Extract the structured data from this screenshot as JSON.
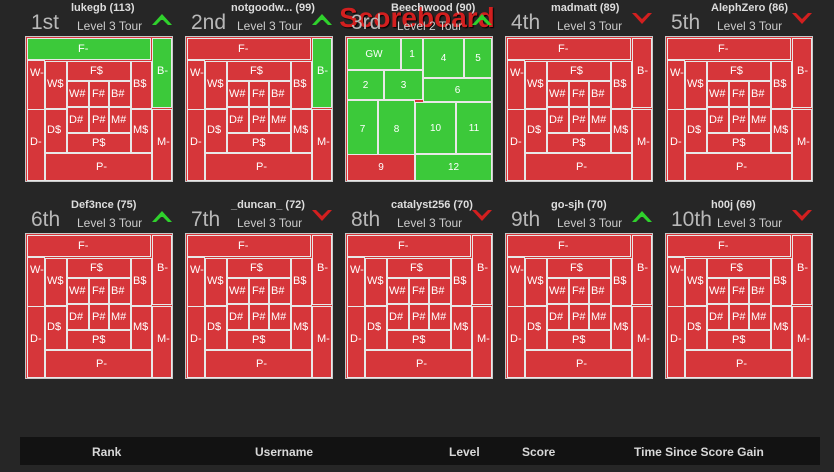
{
  "title": "Scoreboard",
  "entries": [
    {
      "rank": "1st",
      "user": "lukegb (113)",
      "level": "Level 3 Tour",
      "trend": "up",
      "owned": [
        "F-",
        "B-"
      ]
    },
    {
      "rank": "2nd",
      "user": "notgoodw... (99)",
      "level": "Level 3 Tour",
      "trend": "up",
      "owned": [
        "B-"
      ]
    },
    {
      "rank": "3rd",
      "user": "Beechwood (90)",
      "level": "Level 2 Tour",
      "trend": "up",
      "owned": []
    },
    {
      "rank": "4th",
      "user": "madmatt (89)",
      "level": "Level 3 Tour",
      "trend": "down",
      "owned": []
    },
    {
      "rank": "5th",
      "user": "AlephZero (86)",
      "level": "Level 3 Tour",
      "trend": "down",
      "owned": []
    },
    {
      "rank": "6th",
      "user": "Def3nce (75)",
      "level": "Level 3 Tour",
      "trend": "up",
      "owned": []
    },
    {
      "rank": "7th",
      "user": "_duncan_ (72)",
      "level": "Level 3 Tour",
      "trend": "down",
      "owned": []
    },
    {
      "rank": "8th",
      "user": "catalyst256 (70)",
      "level": "Level 3 Tour",
      "trend": "down",
      "owned": []
    },
    {
      "rank": "9th",
      "user": "go-sjh (70)",
      "level": "Level 3 Tour",
      "trend": "up",
      "owned": []
    },
    {
      "rank": "10th",
      "user": "h00j (69)",
      "level": "Level 3 Tour",
      "trend": "down",
      "owned": []
    }
  ],
  "level3_labels": [
    "F-",
    "W-",
    "B-",
    "D-",
    "M-",
    "P-",
    "F$",
    "W$",
    "B$",
    "D$",
    "M$",
    "P$",
    "W#",
    "F#",
    "B#",
    "D#",
    "P#",
    "M#"
  ],
  "level2_tiles": [
    {
      "label": "GW",
      "green": true
    },
    {
      "label": "1",
      "green": true
    },
    {
      "label": "4",
      "green": true
    },
    {
      "label": "5",
      "green": true
    },
    {
      "label": "2",
      "green": true
    },
    {
      "label": "3",
      "green": true
    },
    {
      "label": "6",
      "green": true
    },
    {
      "label": "7",
      "green": true
    },
    {
      "label": "8",
      "green": true
    },
    {
      "label": "10",
      "green": true
    },
    {
      "label": "11",
      "green": true
    },
    {
      "label": "9",
      "green": false
    },
    {
      "label": "12",
      "green": true
    }
  ],
  "footer": {
    "rank": "Rank",
    "username": "Username",
    "level": "Level",
    "score": "Score",
    "time": "Time Since Score Gain"
  },
  "colors": {
    "red": "#d6363a",
    "green": "#3cc93a",
    "title": "#d21f1f",
    "up": "#2fd12c",
    "down": "#d21f1f"
  }
}
